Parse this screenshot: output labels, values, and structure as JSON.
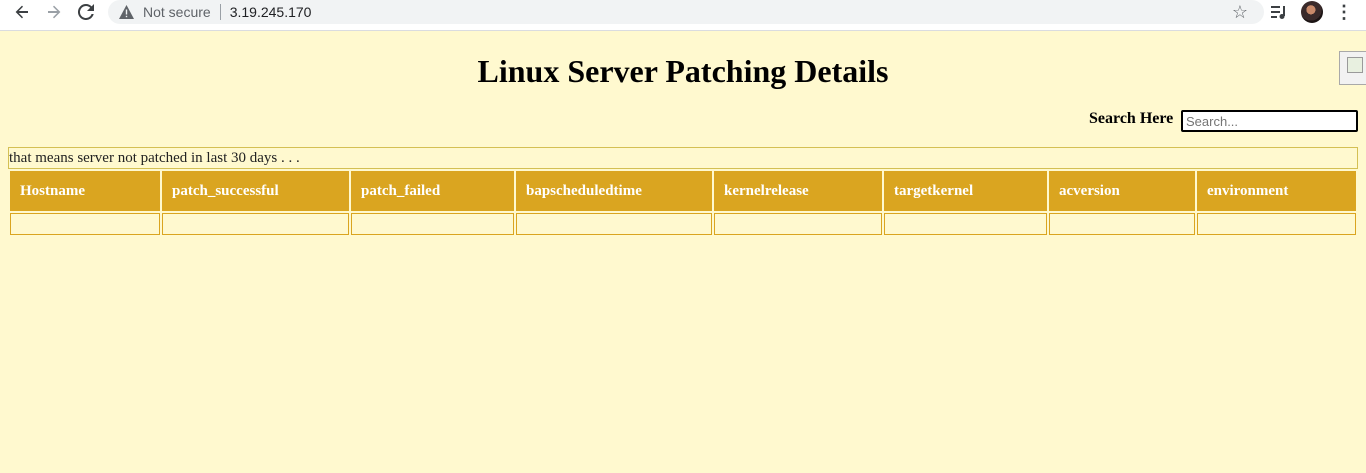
{
  "browser": {
    "security_label": "Not secure",
    "url": "3.19.245.170"
  },
  "page": {
    "title": "Linux Server Patching Details",
    "search_label": "Search Here",
    "search_placeholder": "Search...",
    "search_value": "",
    "notice": "that means server not patched in last 30 days . . ."
  },
  "table": {
    "headers": [
      "Hostname",
      "patch_successful",
      "patch_failed",
      "bapscheduledtime",
      "kernelrelease",
      "targetkernel",
      "acversion",
      "environment"
    ],
    "rows": [
      [
        "",
        "",
        "",
        "",
        "",
        "",
        "",
        ""
      ]
    ]
  },
  "colors": {
    "page_background": "#fff9cf",
    "header_background": "#daa520",
    "header_text": "#ffffff"
  }
}
